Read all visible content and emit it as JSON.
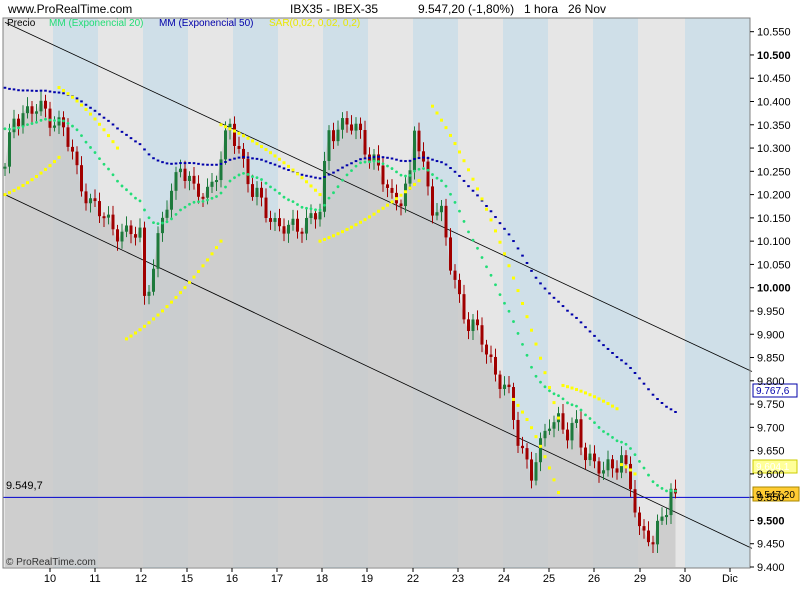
{
  "header": {
    "site": "www.ProRealTime.com",
    "instrument": "IBX35 - IBEX-35",
    "last_price": "9.547,20 (-1,80%)",
    "timeframe": "1 hora",
    "date": "26 Nov"
  },
  "legend": {
    "price": "Precio",
    "ema20": "MM (Exponencial 20)",
    "ema50": "MM (Exponencial 50)",
    "sar": "SAR(0,02, 0,02, 0,2)"
  },
  "footer": {
    "copyright": "© ProRealTime.com"
  },
  "colors": {
    "bull": "#1e7a3c",
    "bear": "#a00000",
    "ema20": "#22dd77",
    "ema50": "#0000aa",
    "sar": "#ffff00",
    "hline": "#0000cc",
    "band_gray": "#e6e6e6",
    "band_blue": "#cfdfe8",
    "area": "#c8c8c8"
  },
  "price_labels": {
    "hline_left": "9.549,7",
    "ema50_tag": "9.767,6",
    "ema20_tag": "9.604,1",
    "price_tag": "9.547,20"
  },
  "chart_data": {
    "type": "candlestick",
    "y_ticks": [
      "10.550",
      "10.500",
      "10.450",
      "10.400",
      "10.350",
      "10.300",
      "10.250",
      "10.200",
      "10.150",
      "10.100",
      "10.050",
      "10.000",
      "9.950",
      "9.900",
      "9.850",
      "9.800",
      "9.750",
      "9.700",
      "9.650",
      "9.600",
      "9.550",
      "9.500",
      "9.450",
      "9.400"
    ],
    "y_bold_ticks": [
      "10.500",
      "10.000",
      "9.500"
    ],
    "ylim": [
      9400,
      10560
    ],
    "x_ticks": [
      "10",
      "11",
      "12",
      "15",
      "16",
      "17",
      "18",
      "19",
      "22",
      "23",
      "24",
      "25",
      "26",
      "29",
      "30",
      "Dic"
    ],
    "hline_value": 9549.7,
    "current_price": 9547.2,
    "trendlines": [
      {
        "from": [
          0,
          10570
        ],
        "to": [
          166,
          9820
        ]
      },
      {
        "from": [
          0,
          10200
        ],
        "to": [
          166,
          9440
        ]
      }
    ]
  }
}
